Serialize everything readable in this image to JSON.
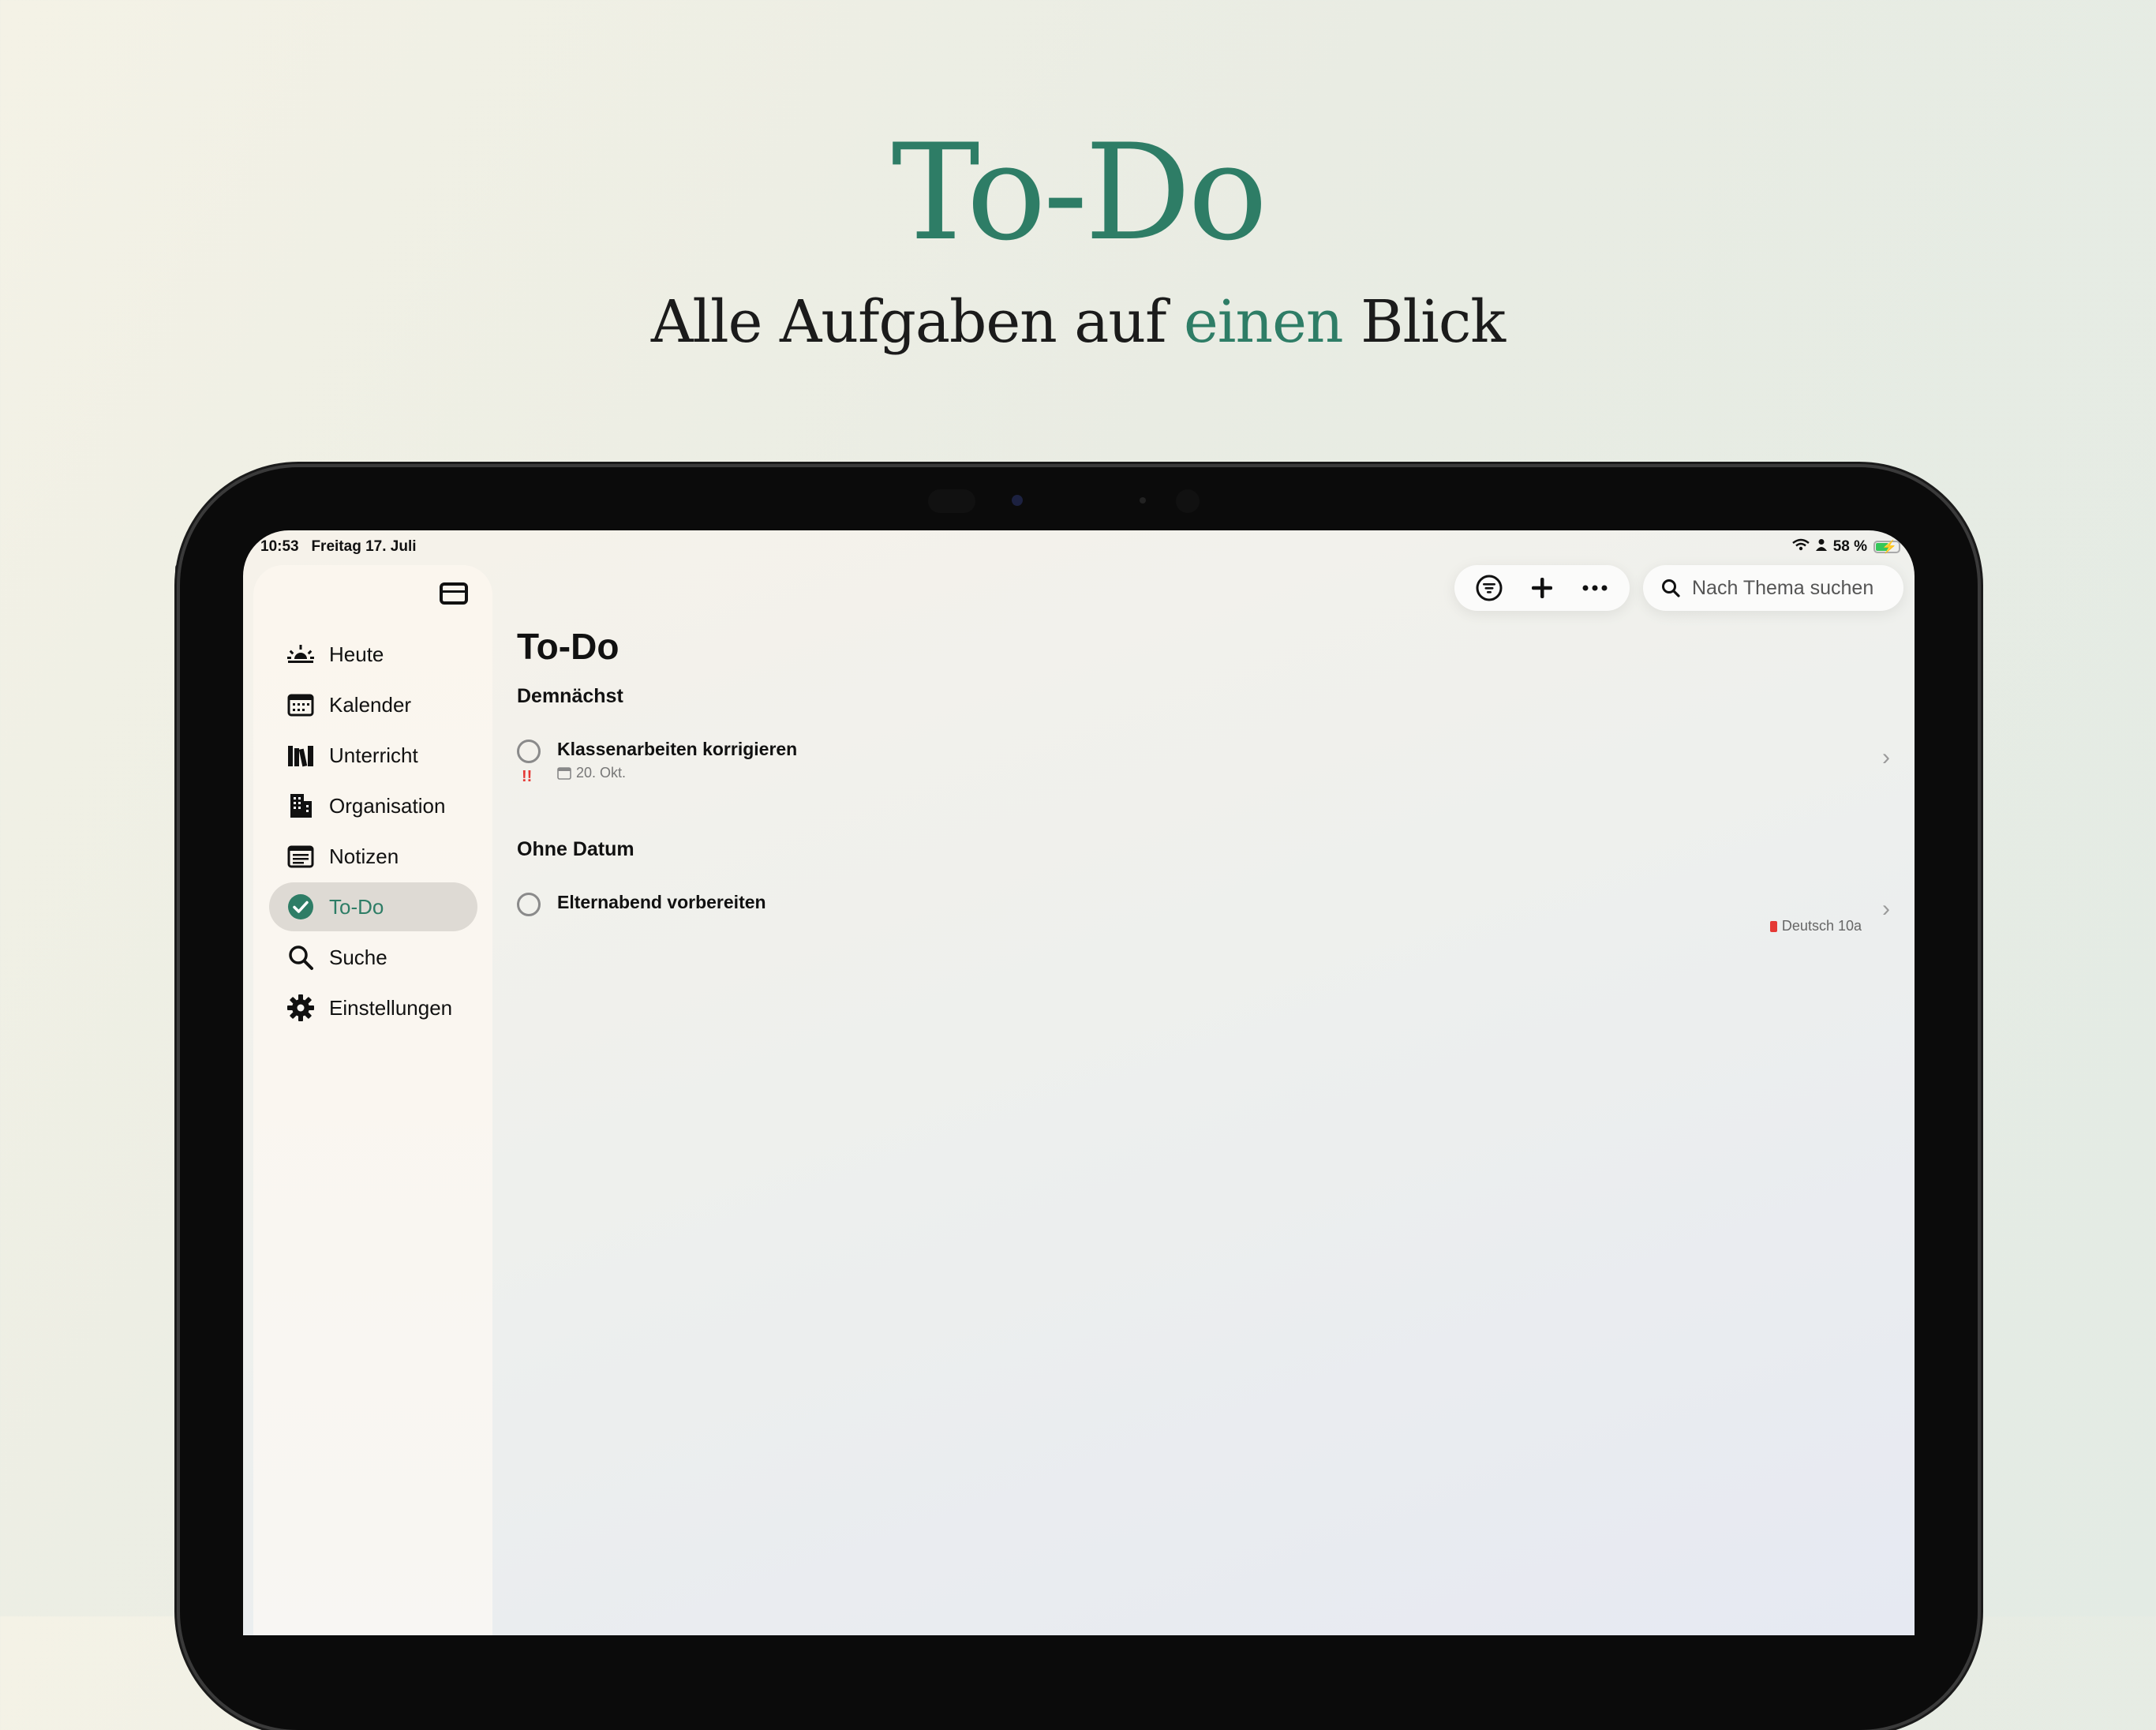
{
  "marketing": {
    "headline": "To-Do",
    "subline_pre": "Alle Aufgaben auf ",
    "subline_accent": "einen",
    "subline_post": " Blick",
    "accent_color": "#2e7d66"
  },
  "status_bar": {
    "time": "10:53",
    "date": "Freitag 17. Juli",
    "battery": "58 %",
    "battery_level": 0.58
  },
  "sidebar": {
    "toggle_icon": "sidebar-toggle-icon",
    "items": [
      {
        "label": "Heute",
        "icon": "sunrise-icon",
        "active": false
      },
      {
        "label": "Kalender",
        "icon": "calendar-icon",
        "active": false
      },
      {
        "label": "Unterricht",
        "icon": "books-icon",
        "active": false
      },
      {
        "label": "Organisation",
        "icon": "building-icon",
        "active": false
      },
      {
        "label": "Notizen",
        "icon": "notes-icon",
        "active": false
      },
      {
        "label": "To-Do",
        "icon": "checkmark-circle-icon",
        "active": true
      },
      {
        "label": "Suche",
        "icon": "search-icon",
        "active": false
      },
      {
        "label": "Einstellungen",
        "icon": "gear-icon",
        "active": false
      }
    ]
  },
  "toolbar": {
    "filter_icon": "filter-icon",
    "add_icon": "plus-icon",
    "more_icon": "ellipsis-icon",
    "search_placeholder": "Nach Thema suchen"
  },
  "main": {
    "title": "To-Do",
    "sections": [
      {
        "heading": "Demnächst",
        "items": [
          {
            "title": "Klassenarbeiten korrigieren",
            "priority": "!!",
            "date": "20. Okt."
          }
        ]
      },
      {
        "heading": "Ohne Datum",
        "items": [
          {
            "title": "Elternabend vorbereiten",
            "tag": "Deutsch 10a",
            "tag_color": "#e53935"
          }
        ]
      }
    ]
  }
}
